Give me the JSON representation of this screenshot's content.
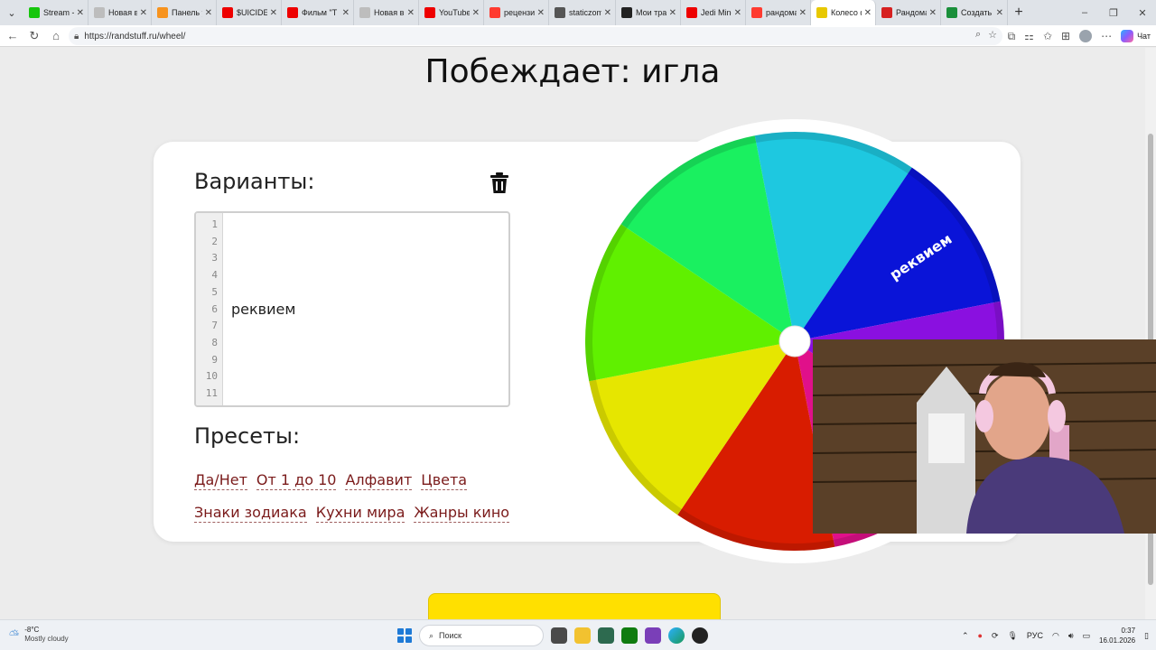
{
  "browser": {
    "tabs": [
      {
        "label": "Stream - k",
        "favicon": "kick-icon",
        "color": "#16c60c"
      },
      {
        "label": "Новая вкл",
        "favicon": "page-icon",
        "color": "#bdbdbd"
      },
      {
        "label": "Панель уп",
        "favicon": "donation-icon",
        "color": "#f7931e"
      },
      {
        "label": "$UICIDEB",
        "favicon": "youtube-icon",
        "color": "#e00"
      },
      {
        "label": "Фильм \"Т",
        "favicon": "youtube-icon",
        "color": "#e00"
      },
      {
        "label": "Новая вкл",
        "favicon": "page-icon",
        "color": "#bdbdbd"
      },
      {
        "label": "YouTube",
        "favicon": "youtube-icon",
        "color": "#e00"
      },
      {
        "label": "рецензия",
        "favicon": "yandex-icon",
        "color": "#ff3b30"
      },
      {
        "label": "staticzom",
        "favicon": "doc-icon",
        "color": "#555"
      },
      {
        "label": "Мои тран",
        "favicon": "da-icon",
        "color": "#222"
      },
      {
        "label": "Jedi Mind",
        "favicon": "youtube-icon",
        "color": "#e00"
      },
      {
        "label": "рандомай",
        "favicon": "yandex-icon",
        "color": "#ff3b30"
      },
      {
        "label": "Колесо ф",
        "favicon": "randstuff-icon",
        "color": "#e8c800",
        "active": true
      },
      {
        "label": "Рандомай",
        "favicon": "opera-icon",
        "color": "#d62020"
      },
      {
        "label": "Создать с",
        "favicon": "green-circle-icon",
        "color": "#1a8f3a"
      }
    ],
    "url": "https://randstuff.ru/wheel/",
    "copilot_label": "Чат"
  },
  "page": {
    "winner_text": "Побеждает: игла",
    "variants_heading": "Варианты:",
    "editor_line_numbers": [
      "1",
      "2",
      "3",
      "4",
      "5",
      "6",
      "7",
      "8",
      "9",
      "10",
      "11"
    ],
    "editor_line_6_text": "реквием",
    "presets_heading": "Пресеты:",
    "presets": [
      "Да/Нет",
      "От 1 до 10",
      "Алфавит",
      "Цвета",
      "Знаки зодиака",
      "Кухни мира",
      "Жанры кино"
    ],
    "wheel_label": "реквием",
    "wheel_colors": [
      "#1ec8e0",
      "#0a14d8",
      "#8a10e0",
      "#e0108a",
      "#d81c00",
      "#e6e600",
      "#60f000",
      "#1af060"
    ]
  },
  "taskbar": {
    "temperature": "-8°C",
    "weather": "Mostly cloudy",
    "search_placeholder": "Поиск",
    "language": "РУС",
    "time": "0:37",
    "date": "16.01.2026"
  }
}
